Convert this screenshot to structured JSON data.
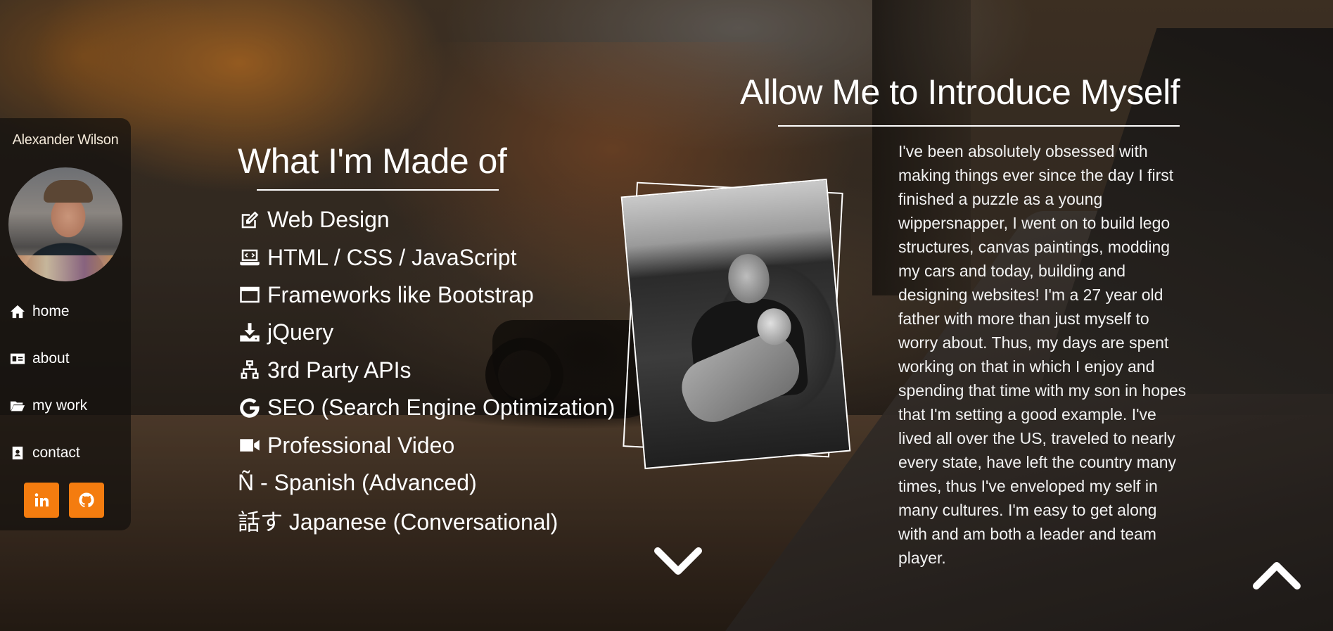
{
  "sidebar": {
    "name": "Alexander Wilson",
    "avatar_icon": "profile-photo",
    "nav": [
      {
        "label": "home",
        "icon": "home-icon"
      },
      {
        "label": "about",
        "icon": "id-card-icon"
      },
      {
        "label": "my work",
        "icon": "folder-open-icon"
      },
      {
        "label": "contact",
        "icon": "address-book-icon"
      }
    ],
    "social": [
      {
        "label": "in",
        "icon": "linkedin-icon"
      },
      {
        "label": "github",
        "icon": "github-icon"
      }
    ],
    "accent_color": "#f47c0f"
  },
  "skills": {
    "title": "What I'm Made of",
    "items": [
      {
        "label": "Web Design",
        "icon": "edit-icon"
      },
      {
        "label": "HTML / CSS / JavaScript",
        "icon": "laptop-code-icon"
      },
      {
        "label": "Frameworks like Bootstrap",
        "icon": "window-icon"
      },
      {
        "label": "jQuery",
        "icon": "download-icon"
      },
      {
        "label": "3rd Party APIs",
        "icon": "network-icon"
      },
      {
        "label": "SEO (Search Engine Optimization)",
        "icon": "google-icon"
      },
      {
        "label": "Professional Video",
        "icon": "video-icon"
      },
      {
        "label": "Ñ - Spanish (Advanced)",
        "icon": "none"
      },
      {
        "label": "話す Japanese (Conversational)",
        "icon": "none"
      }
    ]
  },
  "about": {
    "title": "Allow Me to Introduce Myself",
    "body": "I've been absolutely obsessed with making things ever since the day I first finished a puzzle as a young wippersnapper, I went on to build lego structures, canvas paintings, modding my cars and today, building and designing websites! I'm a 27 year old father with more than just myself to worry about. Thus, my days are spent working on that in which I enjoy and spending that time with my son in hopes that I'm setting a good example. I've lived all over the US, traveled to nearly every state, have left the country many times, thus I've enveloped my self in many cultures. I'm easy to get along with and am both a leader and team player."
  },
  "navigation": {
    "scroll_down_icon": "chevron-down-icon",
    "scroll_up_icon": "chevron-up-icon"
  }
}
